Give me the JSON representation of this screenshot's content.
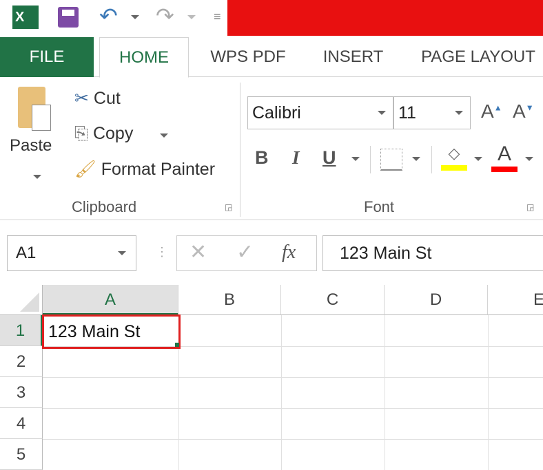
{
  "qat": {
    "icons": [
      "excel-logo-icon",
      "save-icon",
      "undo-icon",
      "redo-icon",
      "customize-icon"
    ]
  },
  "tabs": [
    "FILE",
    "HOME",
    "WPS PDF",
    "INSERT",
    "PAGE LAYOUT"
  ],
  "clipboard": {
    "paste": "Paste",
    "cut": "Cut",
    "copy": "Copy",
    "format_painter": "Format Painter",
    "group": "Clipboard"
  },
  "font": {
    "name": "Calibri",
    "size": "11",
    "group": "Font",
    "bold": "B",
    "italic": "I",
    "underline": "U",
    "grow": "A",
    "shrink": "A",
    "color_letter": "A",
    "fill_color": "#ffff00",
    "font_color": "#ff0000"
  },
  "formula": {
    "name_box": "A1",
    "fx": "fx",
    "value": "123 Main St"
  },
  "columns": [
    "A",
    "B",
    "C",
    "D",
    "E"
  ],
  "rows": [
    "1",
    "2",
    "3",
    "4",
    "5"
  ],
  "cells": {
    "A1": "123 Main St"
  }
}
